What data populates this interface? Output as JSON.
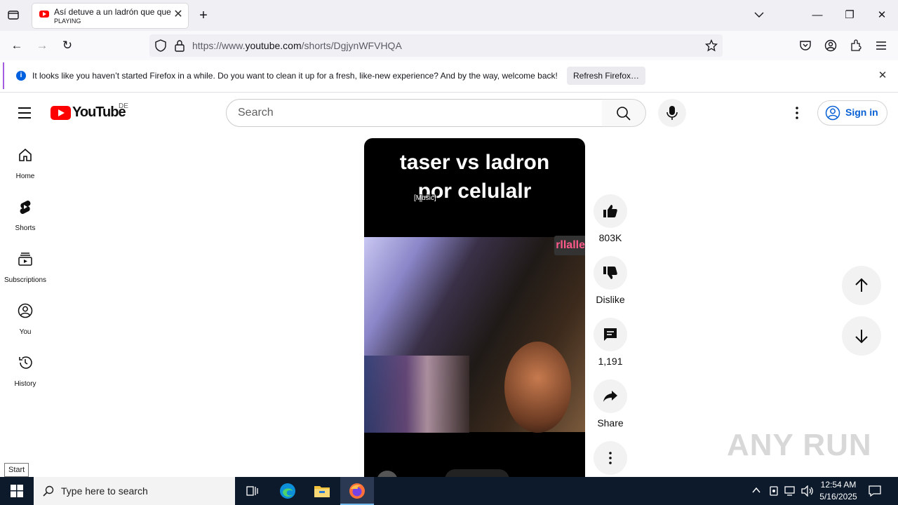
{
  "browser": {
    "tab_title": "Así detuve a un ladrón que que",
    "tab_status": "PLAYING",
    "url_prefix": "https://www.",
    "url_domain": "youtube.com",
    "url_path": "/shorts/DgjynWFVHQA",
    "notification_text": "It looks like you haven’t started Firefox in a while. Do you want to clean it up for a fresh, like-new experience? And by the way, welcome back!",
    "notification_button": "Refresh Firefox…"
  },
  "youtube": {
    "logo_text": "YouTube",
    "region": "DE",
    "search_placeholder": "Search",
    "sign_in": "Sign in",
    "sidebar": [
      {
        "label": "Home",
        "icon": "home-icon"
      },
      {
        "label": "Shorts",
        "icon": "shorts-icon"
      },
      {
        "label": "Subscriptions",
        "icon": "subscriptions-icon"
      },
      {
        "label": "You",
        "icon": "you-icon"
      },
      {
        "label": "History",
        "icon": "history-icon"
      }
    ]
  },
  "video": {
    "overlay_line1": "taser vs ladron",
    "overlay_line2": "por celulalr",
    "caption": "[Music]",
    "tag": "rllalle"
  },
  "actions": {
    "likes": "803K",
    "dislike": "Dislike",
    "comments": "1,191",
    "share": "Share"
  },
  "watermark": "ANY RUN",
  "start_tooltip": "Start",
  "taskbar": {
    "search_placeholder": "Type here to search",
    "time": "12:54 AM",
    "date": "5/16/2025"
  }
}
